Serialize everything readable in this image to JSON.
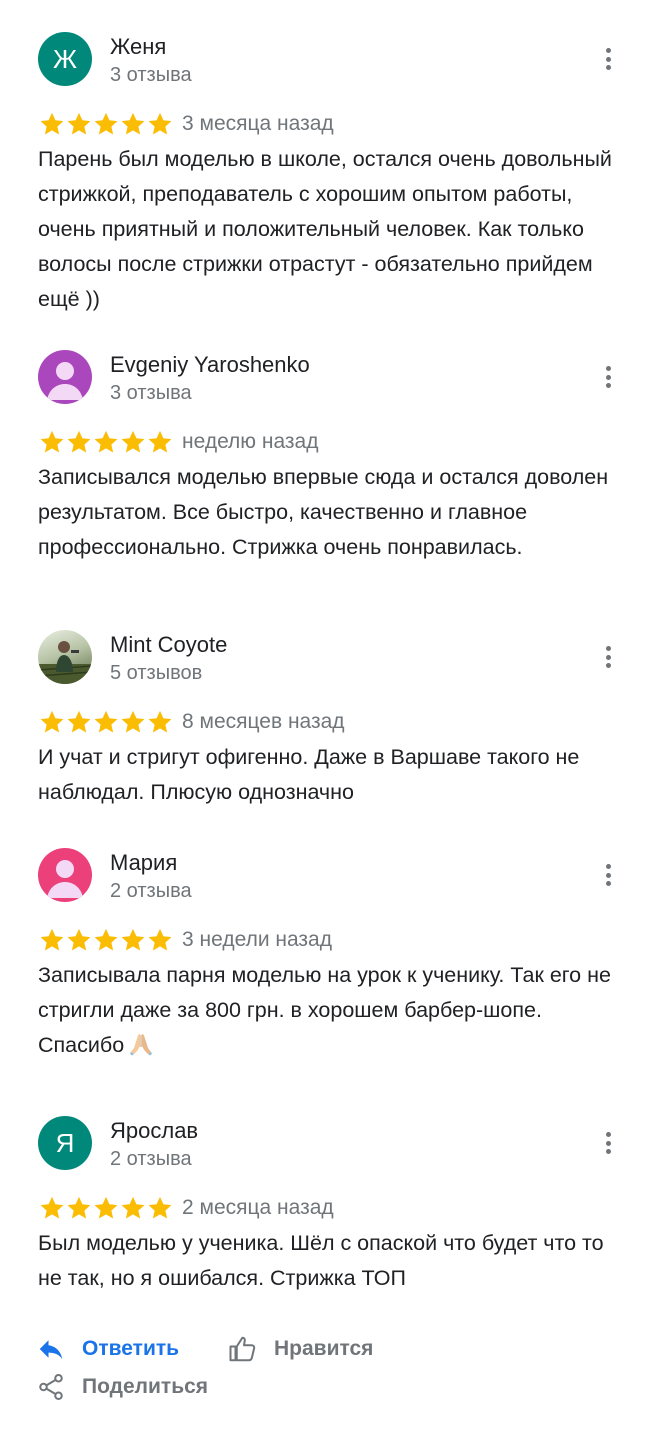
{
  "reviews": [
    {
      "name": "Женя",
      "avatar_letter": "Ж",
      "count": "3 отзыва",
      "rating": 5,
      "date": "3 месяца назад",
      "text": "Парень был моделью в школе, остался очень довольный стрижкой, преподаватель с хорошим опытом работы, очень приятный и положительный человек. Как только волосы после стрижки отрастут - обязательно прийдем ещё ))"
    },
    {
      "name": "Evgeniy Yaroshenko",
      "avatar_icon": "person-icon",
      "count": "3 отзыва",
      "rating": 5,
      "date": "неделю назад",
      "text": "Записывался моделью впервые сюда и остался доволен результатом. Все быстро, качественно и главное профессионально. Стрижка очень понравилась."
    },
    {
      "name": "Mint Coyote",
      "avatar_icon": "profile-photo",
      "count": "5 отзывов",
      "rating": 5,
      "date": "8 месяцев назад",
      "text": "И учат и стригут офигенно. Даже в Варшаве такого не наблюдал. Плюсую однозначно"
    },
    {
      "name": "Мария",
      "avatar_icon": "person-icon",
      "count": "2 отзыва",
      "rating": 5,
      "date": "3 недели назад",
      "text": "Записывала парня моделью на урок к ученику. Так его не стригли даже за 800 грн. в хорошем барбер-шопе. Спасибо",
      "emoji": "folded-hands-emoji"
    },
    {
      "name": "Ярослав",
      "avatar_letter": "Я",
      "count": "2 отзыва",
      "rating": 5,
      "date": "2 месяца назад",
      "text": "Был моделью у ученика. Шёл с опаской что будет что то не так, но я ошибался. Стрижка ТОП"
    }
  ],
  "actions": {
    "reply_label": "Ответить",
    "like_label": "Нравится",
    "share_label": "Поделиться"
  },
  "colors": {
    "star": "#fbbc04",
    "accent": "#1a73e8",
    "secondary_text": "#70757a",
    "avatar_teal": "#00897b",
    "avatar_purple": "#ab47bc",
    "avatar_pink": "#ec407a"
  }
}
